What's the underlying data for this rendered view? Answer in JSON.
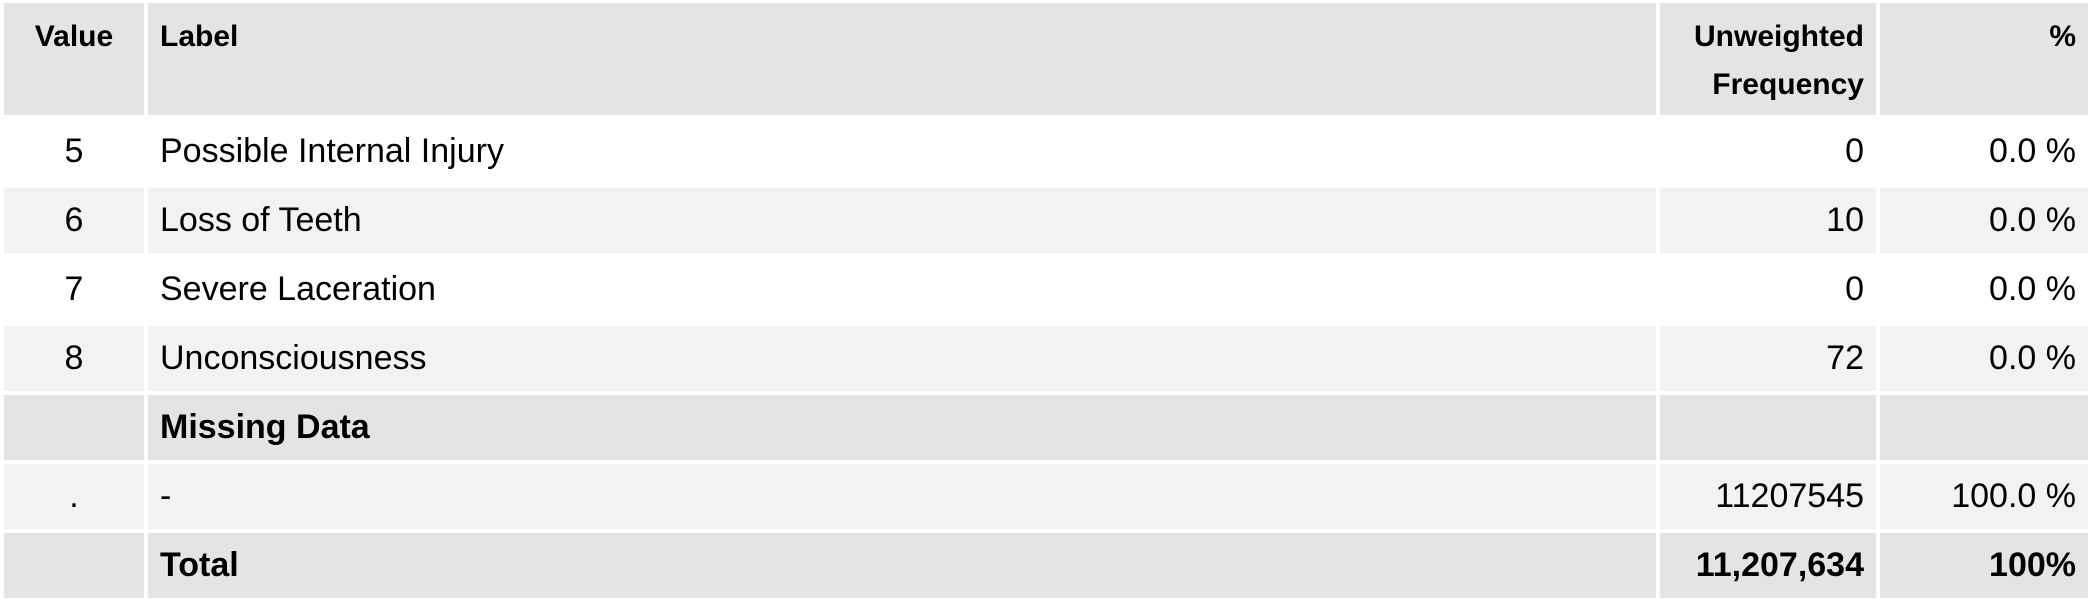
{
  "table": {
    "headers": {
      "value": "Value",
      "label": "Label",
      "frequency_line1": "Unweighted",
      "frequency_line2": "Frequency",
      "percent": "%"
    },
    "rows": [
      {
        "value": "5",
        "label": "Possible Internal Injury",
        "frequency": "0",
        "percent": "0.0 %"
      },
      {
        "value": "6",
        "label": "Loss of Teeth",
        "frequency": "10",
        "percent": "0.0 %"
      },
      {
        "value": "7",
        "label": "Severe Laceration",
        "frequency": "0",
        "percent": "0.0 %"
      },
      {
        "value": "8",
        "label": "Unconsciousness",
        "frequency": "72",
        "percent": "0.0 %"
      }
    ],
    "missing_section": {
      "title": "Missing Data",
      "rows": [
        {
          "value": ".",
          "label": "-",
          "frequency": "11207545",
          "percent": "100.0 %"
        }
      ]
    },
    "total": {
      "label": "Total",
      "frequency": "11,207,634",
      "percent": "100%"
    }
  },
  "colors": {
    "header_bg": "#e4e4e4",
    "row_alt_bg": "#f2f2f2",
    "row_bg": "#ffffff"
  }
}
